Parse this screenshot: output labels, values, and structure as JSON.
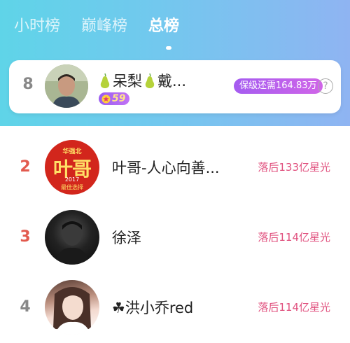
{
  "tabs": [
    {
      "label": "小时榜",
      "active": false
    },
    {
      "label": "巅峰榜",
      "active": false
    },
    {
      "label": "总榜",
      "active": true
    }
  ],
  "my_entry": {
    "rank": "8",
    "name": "呆梨",
    "name_suffix": "戴...",
    "level": "59",
    "protect_text": "保级还需164.83万",
    "help_icon": "?"
  },
  "ranking": [
    {
      "rank": "2",
      "name": "叶哥-人心向善...",
      "behind": "落后133亿星光",
      "avatar_text": {
        "top": "华强北",
        "main": "叶哥",
        "year": "2017",
        "bottom": "最佳选择"
      }
    },
    {
      "rank": "3",
      "name": "徐泽",
      "behind": "落后114亿星光"
    },
    {
      "rank": "4",
      "name": "☘洪小乔red",
      "behind": "落后114亿星光"
    }
  ],
  "colors": {
    "header_gradient_start": "#5fd4e8",
    "header_gradient_end": "#8fb4f2",
    "rank_red": "#e25a4e",
    "behind_pink": "#e0507e",
    "badge_purple": "#a55cf0"
  },
  "icons": [
    "pear-icon",
    "star-icon",
    "help-icon"
  ]
}
